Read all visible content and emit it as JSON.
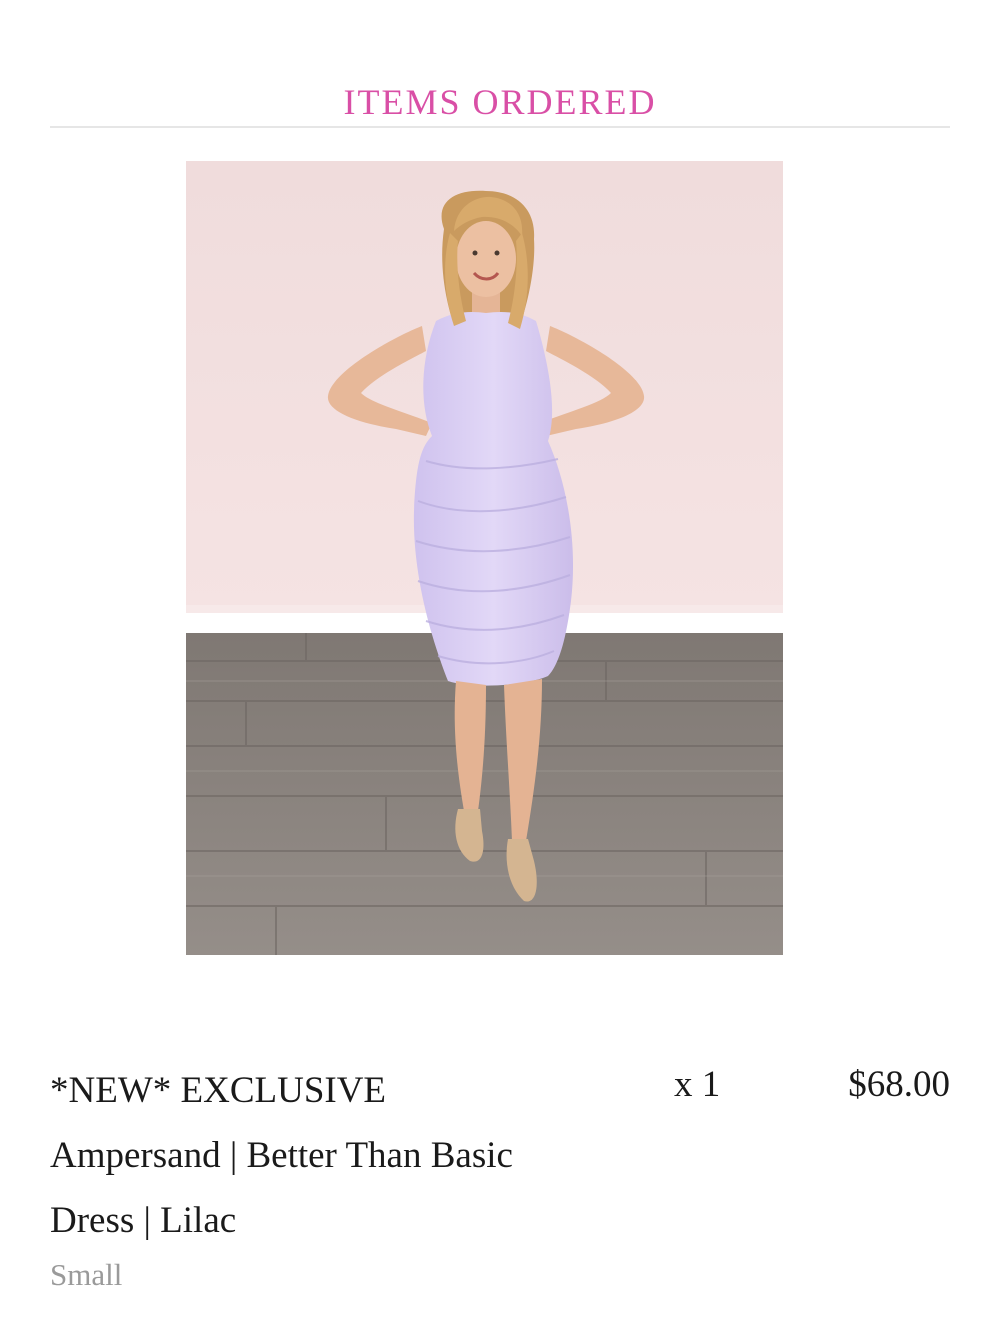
{
  "section": {
    "title": "ITEMS ORDERED",
    "title_color": "#d94fa6"
  },
  "item": {
    "image_icon": "product-photo-lilac-dress",
    "name": "*NEW* EXCLUSIVE Ampersand | Better Than Basic Dress | Lilac",
    "variant": "Small",
    "variant_color": "#9a9a9a",
    "quantity": "x 1",
    "price": "$68.00"
  },
  "colors": {
    "wall": "#f1dede",
    "floor": "#8a8380",
    "dress": "#d9cdf2",
    "hair": "#d8a86a",
    "skin": "#e8b99a",
    "shoes": "#d3b592"
  }
}
